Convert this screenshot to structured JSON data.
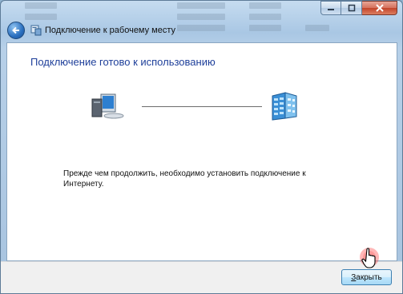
{
  "window": {
    "title": "Подключение к рабочему месту",
    "caption_buttons": {
      "minimize_icon": "minimize-icon",
      "maximize_icon": "maximize-icon",
      "close_icon": "close-icon"
    }
  },
  "content": {
    "heading": "Подключение готово к использованию",
    "info_text": "Прежде чем продолжить, необходимо установить подключение к Интернету."
  },
  "footer": {
    "close_button_label": "Закрыть",
    "close_button_access_key": "З",
    "close_button_rest": "акрыть"
  },
  "colors": {
    "heading": "#1e3f9a",
    "glass": "#a9c7e4",
    "close_caption": "#c2442a"
  }
}
